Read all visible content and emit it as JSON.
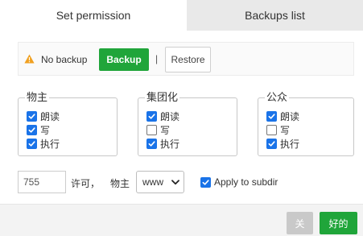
{
  "tabs": [
    {
      "label": "Set permission",
      "active": true
    },
    {
      "label": "Backups list",
      "active": false
    }
  ],
  "backup": {
    "status_text": "No backup",
    "backup_label": "Backup",
    "separator": "|",
    "restore_label": "Restore",
    "warn_icon": "warning-icon",
    "warn_color": "#f0a020"
  },
  "groups": [
    {
      "title": "物主",
      "perms": [
        {
          "label": "朗读",
          "checked": true
        },
        {
          "label": "写",
          "checked": true
        },
        {
          "label": "执行",
          "checked": true
        }
      ]
    },
    {
      "title": "集团化",
      "perms": [
        {
          "label": "朗读",
          "checked": true
        },
        {
          "label": "写",
          "checked": false
        },
        {
          "label": "执行",
          "checked": true
        }
      ]
    },
    {
      "title": "公众",
      "perms": [
        {
          "label": "朗读",
          "checked": true
        },
        {
          "label": "写",
          "checked": false
        },
        {
          "label": "执行",
          "checked": true
        }
      ]
    }
  ],
  "controls": {
    "permission_value": "755",
    "permission_label": "许可，",
    "owner_label": "物主",
    "owner_value": "www",
    "subdir_label": "Apply to subdir",
    "subdir_checked": true
  },
  "footer": {
    "close_label": "关",
    "ok_label": "好的"
  },
  "colors": {
    "accent": "#20a53a",
    "checkbox": "#1a73e8",
    "disabled": "#c9c9c9"
  }
}
